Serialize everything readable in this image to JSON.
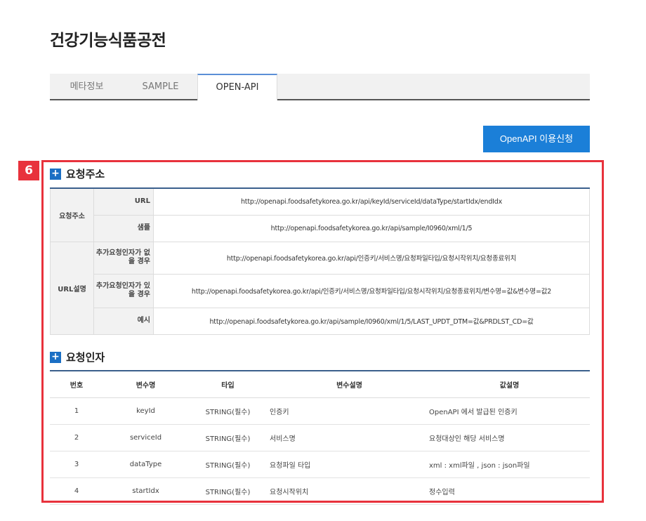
{
  "page": {
    "title": "건강기능식품공전"
  },
  "tabs": [
    {
      "label": "메타정보",
      "active": false
    },
    {
      "label": "SAMPLE",
      "active": false
    },
    {
      "label": "OPEN-API",
      "active": true
    }
  ],
  "apply_button": {
    "label": "OpenAPI 이용신청"
  },
  "highlight": {
    "marker": "6",
    "color": "#e8323c"
  },
  "request_url": {
    "heading": "요청주소",
    "groups": [
      {
        "label": "요청주소",
        "rows": [
          {
            "label": "URL",
            "value": "http://openapi.foodsafetykorea.go.kr/api/keyId/serviceId/dataType/startIdx/endIdx"
          },
          {
            "label": "샘플",
            "value": "http://openapi.foodsafetykorea.go.kr/api/sample/I0960/xml/1/5"
          }
        ]
      },
      {
        "label": "URL설명",
        "rows": [
          {
            "label": "추가요청인자가 없을 경우",
            "value": "http://openapi.foodsafetykorea.go.kr/api/인증키/서비스명/요청파일타입/요청시작위치/요청종료위치"
          },
          {
            "label": "추가요청인자가 있을 경우",
            "value": "http://openapi.foodsafetykorea.go.kr/api/인증키/서비스명/요청파일타입/요청시작위치/요청종료위치/변수명=값&변수명=값2"
          },
          {
            "label": "예시",
            "value": "http://openapi.foodsafetykorea.go.kr/api/sample/I0960/xml/1/5/LAST_UPDT_DTM=값&PRDLST_CD=값"
          }
        ]
      }
    ]
  },
  "request_params": {
    "heading": "요청인자",
    "columns": [
      "번호",
      "변수명",
      "타입",
      "변수설명",
      "값설명"
    ],
    "rows": [
      {
        "no": "1",
        "name": "keyId",
        "type": "STRING(필수)",
        "desc": "인증키",
        "val": "OpenAPI 에서 발급된 인증키"
      },
      {
        "no": "2",
        "name": "serviceId",
        "type": "STRING(필수)",
        "desc": "서비스명",
        "val": "요청대상인 해당 서비스명"
      },
      {
        "no": "3",
        "name": "dataType",
        "type": "STRING(필수)",
        "desc": "요청파일 타입",
        "val": "xml : xml파일 , json : json파일"
      },
      {
        "no": "4",
        "name": "startIdx",
        "type": "STRING(필수)",
        "desc": "요청시작위치",
        "val": "정수입력"
      }
    ]
  },
  "colors": {
    "accent": "#1b7fd8",
    "icon": "#1b6fc4",
    "table_rule": "#3a5f8c"
  }
}
